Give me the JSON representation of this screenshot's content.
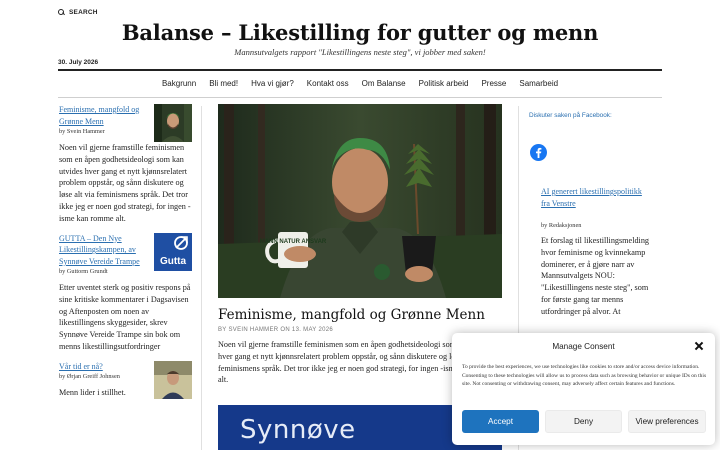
{
  "header": {
    "search_label": "SEARCH",
    "site_title": "Balanse – Likestilling for gutter og menn",
    "tagline": "Mannsutvalgets rapport \"Likestillingens neste steg\", vi jobber med saken!",
    "date": "30. July 2026"
  },
  "nav": {
    "items": [
      "Bakgrunn",
      "Bli med!",
      "Hva vi gjør?",
      "Kontakt oss",
      "Om Balanse",
      "Politisk arbeid",
      "Presse",
      "Samarbeid"
    ]
  },
  "left_posts": [
    {
      "title": "Feminisme, mangfold og Grønne Menn",
      "byline": "by Svein Hammer",
      "excerpt": "Noen vil gjerne framstille feminismen som en åpen godhetsideologi som kan utvides hver gang et nytt kjønnsrelatert problem oppstår, og sånn diskutere og løse alt via feminismens språk. Det tror ikke jeg er noen god strategi, for ingen -isme kan romme alt."
    },
    {
      "title": "GUTTA – Den Nye Likestillingskampen, av Synnøve Vereide Trampe",
      "byline": "by Guttorm Grundt",
      "thumb_text": "Gutta",
      "excerpt": "Etter uventet sterk og positiv respons på sine kritiske kommentarer i Dagsavisen og Aftenposten om noen av likestillingens skyggesider, skrev Synnøve Vereide Trampe sin bok om menns likestillingsutfordringer"
    },
    {
      "title": "Vår tid er nå?",
      "byline": "by Ørjan Greiff Johnsen",
      "excerpt": "Menn lider i stillhet."
    }
  ],
  "main_post": {
    "mug_text": "MANN NATUR ANSVAR",
    "title": "Feminisme, mangfold og Grønne Menn",
    "byline": "BY SVEIN HAMMER ON 13. MAY 2026",
    "excerpt": "Noen vil gjerne framstille feminismen som en åpen godhetsideologi som kan utvides hver gang et nytt kjønnsrelatert problem oppstår, og sånn diskutere og løse alt via feminismens språk. Det tror ikke jeg er noen god strategi, for ingen -isme kan romme alt."
  },
  "next_post": {
    "banner_text": "Synnøve"
  },
  "right_sidebar": {
    "facebook_text": "Diskuter saken på Facebook:",
    "post": {
      "title": "AI generert likestillingspolitikk fra Venstre",
      "byline": "by Redaksjonen",
      "excerpt": "Et forslag til likestillingsmelding hvor feminisme og kvinnekamp dominerer, er å gjøre narr av Mannsutvalgets NOU: \"Likestillingens neste steg\", som for første gang tar menns utfordringer på alvor. At"
    }
  },
  "consent": {
    "title": "Manage Consent",
    "text": "To provide the best experiences, we use technologies like cookies to store and/or access device information. Consenting to these technologies will allow us to process data such as browsing behavior or unique IDs on this site. Not consenting or withdrawing consent, may adversely affect certain features and functions.",
    "accept_label": "Accept",
    "deny_label": "Deny",
    "preferences_label": "View preferences"
  },
  "colors": {
    "link": "#2a6fb0",
    "accept_button": "#1e73be",
    "facebook": "#1877f2",
    "gutta_badge": "#1f4fa3",
    "banner": "#15398a"
  }
}
